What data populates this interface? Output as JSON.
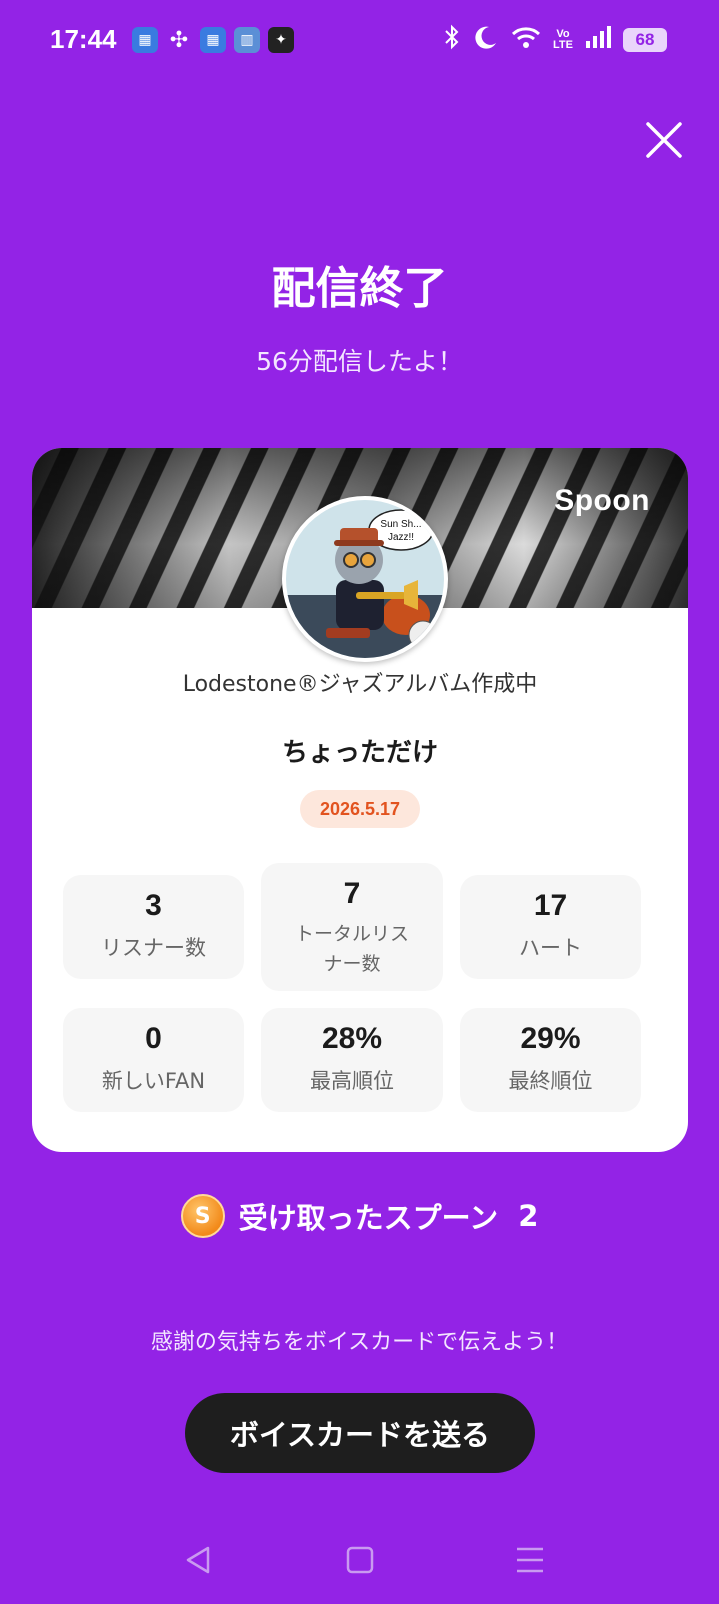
{
  "status_bar": {
    "time": "17:44",
    "volte": "Vo\nLTE",
    "battery": "68"
  },
  "header": {
    "title": "配信終了",
    "subtitle": "56分配信したよ！"
  },
  "card": {
    "brand": "Spoon",
    "avatar_bubble": "Sun Sh... Jazz!!",
    "dj_name": "Lodestone®ジャズアルバム作成中",
    "broadcast_title": "ちょっただけ",
    "date": "2026.5.17",
    "stats": [
      {
        "value": "3",
        "label": "リスナー数"
      },
      {
        "value": "7",
        "label": "トータルリスナー数"
      },
      {
        "value": "17",
        "label": "ハート"
      },
      {
        "value": "0",
        "label": "新しいFAN"
      },
      {
        "value": "28%",
        "label": "最高順位"
      },
      {
        "value": "29%",
        "label": "最終順位"
      }
    ]
  },
  "spoons": {
    "icon": "S",
    "label": "受け取ったスプーン",
    "count": "2"
  },
  "voice_card": {
    "message": "感謝の気持ちをボイスカードで伝えよう！",
    "button_label": "ボイスカードを送る"
  },
  "colors": {
    "background": "#9323E6",
    "button": "#1E1E1E",
    "date_badge_text": "#E2531F"
  }
}
